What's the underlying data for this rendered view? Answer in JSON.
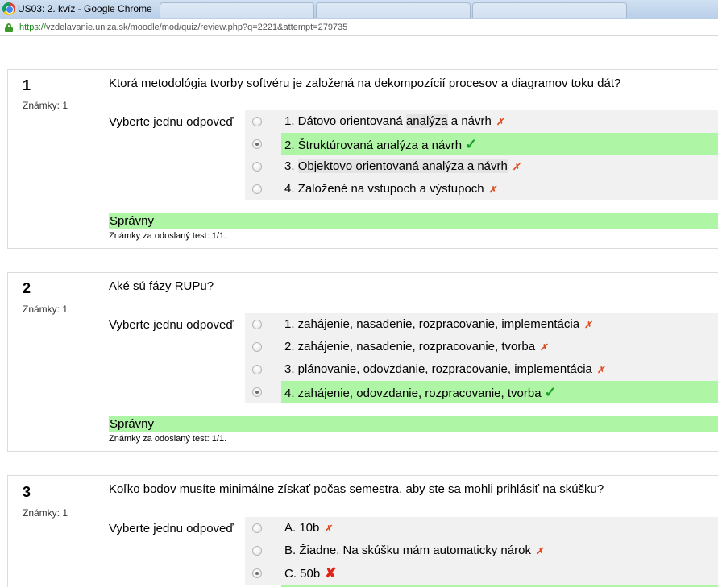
{
  "browser": {
    "window_title": "US03: 2. kvíz - Google Chrome",
    "url_scheme": "https://",
    "url_rest": "vzdelavanie.uniza.sk/moodle/mod/quiz/review.php?q=2221&attempt=279735"
  },
  "questions": [
    {
      "number": "1",
      "marks": "Známky: 1",
      "text": "Ktorá metodológia tvorby softvéru je založená na dekompozícií procesov a diagramov toku dát?",
      "prompt": "Vyberte jednu odpoveď",
      "answers": [
        {
          "label": "1. Dátovo orientovaná ",
          "hl": "analýza",
          "rest": " a návrh",
          "mark": "✗"
        },
        {
          "label": "2. Štruktúrovaná analýza a návrh",
          "mark": "✓"
        },
        {
          "label": "3. ",
          "hl": "Objektovo orientovaná analýza a návrh",
          "rest": "",
          "mark": "✗"
        },
        {
          "label": "4. Založené na vstupoch a výstupoch",
          "mark": "✗"
        }
      ],
      "feedback": "Správny",
      "submitted": "Známky za odoslaný test: 1/1."
    },
    {
      "number": "2",
      "marks": "Známky: 1",
      "text": "Aké sú fázy RUPu?",
      "prompt": "Vyberte jednu odpoveď",
      "answers": [
        {
          "label": "1. zahájenie, nasadenie, rozpracovanie, implementácia",
          "mark": "✗"
        },
        {
          "label": "2. zahájenie, nasadenie, rozpracovanie, tvorba",
          "mark": "✗"
        },
        {
          "label": "3. plánovanie, odovzdanie, rozpracovanie, implementácia",
          "mark": "✗"
        },
        {
          "label": "4. zahájenie, odovzdanie, rozpracovanie, tvorba",
          "mark": "✓"
        }
      ],
      "feedback": "Správny",
      "submitted": "Známky za odoslaný test: 1/1."
    },
    {
      "number": "3",
      "marks": "Známky: 1",
      "text": "Koľko bodov musíte minimálne získať počas semestra, aby ste sa mohli prihlásiť na skúšku?",
      "prompt": "Vyberte jednu odpoveď",
      "answers": [
        {
          "label": "A. 10b",
          "mark": "✗"
        },
        {
          "label": "B. Žiadne. Na skúšku mám automaticky nárok",
          "mark": "✗"
        },
        {
          "label": "C. 50b",
          "mark": "✘"
        }
      ]
    }
  ]
}
